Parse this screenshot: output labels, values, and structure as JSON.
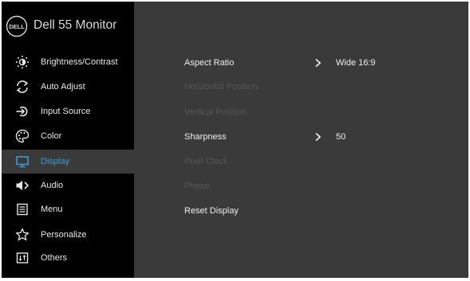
{
  "header": {
    "logo_text": "DELL",
    "title": "Dell 55 Monitor"
  },
  "sidebar": {
    "items": [
      {
        "label": "Brightness/Contrast",
        "icon": "brightness-icon",
        "selected": false
      },
      {
        "label": "Auto Adjust",
        "icon": "auto-adjust-icon",
        "selected": false
      },
      {
        "label": "Input Source",
        "icon": "input-source-icon",
        "selected": false
      },
      {
        "label": "Color",
        "icon": "color-palette-icon",
        "selected": false
      },
      {
        "label": "Display",
        "icon": "display-icon",
        "selected": true
      },
      {
        "label": "Audio",
        "icon": "speaker-icon",
        "selected": false
      },
      {
        "label": "Menu",
        "icon": "menu-icon",
        "selected": false
      },
      {
        "label": "Personalize",
        "icon": "star-icon",
        "selected": false
      },
      {
        "label": "Others",
        "icon": "others-icon",
        "selected": false
      }
    ]
  },
  "main": {
    "rows": [
      {
        "label": "Aspect Ratio",
        "enabled": true,
        "value": "Wide 16:9"
      },
      {
        "label": "Horizontal Position",
        "enabled": false,
        "value": ""
      },
      {
        "label": "Vertical Position",
        "enabled": false,
        "value": ""
      },
      {
        "label": "Sharpness",
        "enabled": true,
        "value": "50"
      },
      {
        "label": "Pixel Clock",
        "enabled": false,
        "value": ""
      },
      {
        "label": "Phase",
        "enabled": false,
        "value": ""
      },
      {
        "label": "Reset Display",
        "enabled": true,
        "value": ""
      }
    ]
  },
  "colors": {
    "sidebar_bg": "#000000",
    "panel_bg": "#3a3a3a",
    "accent": "#3d9de0",
    "text": "#e6e6e6",
    "disabled_text": "#555555"
  }
}
